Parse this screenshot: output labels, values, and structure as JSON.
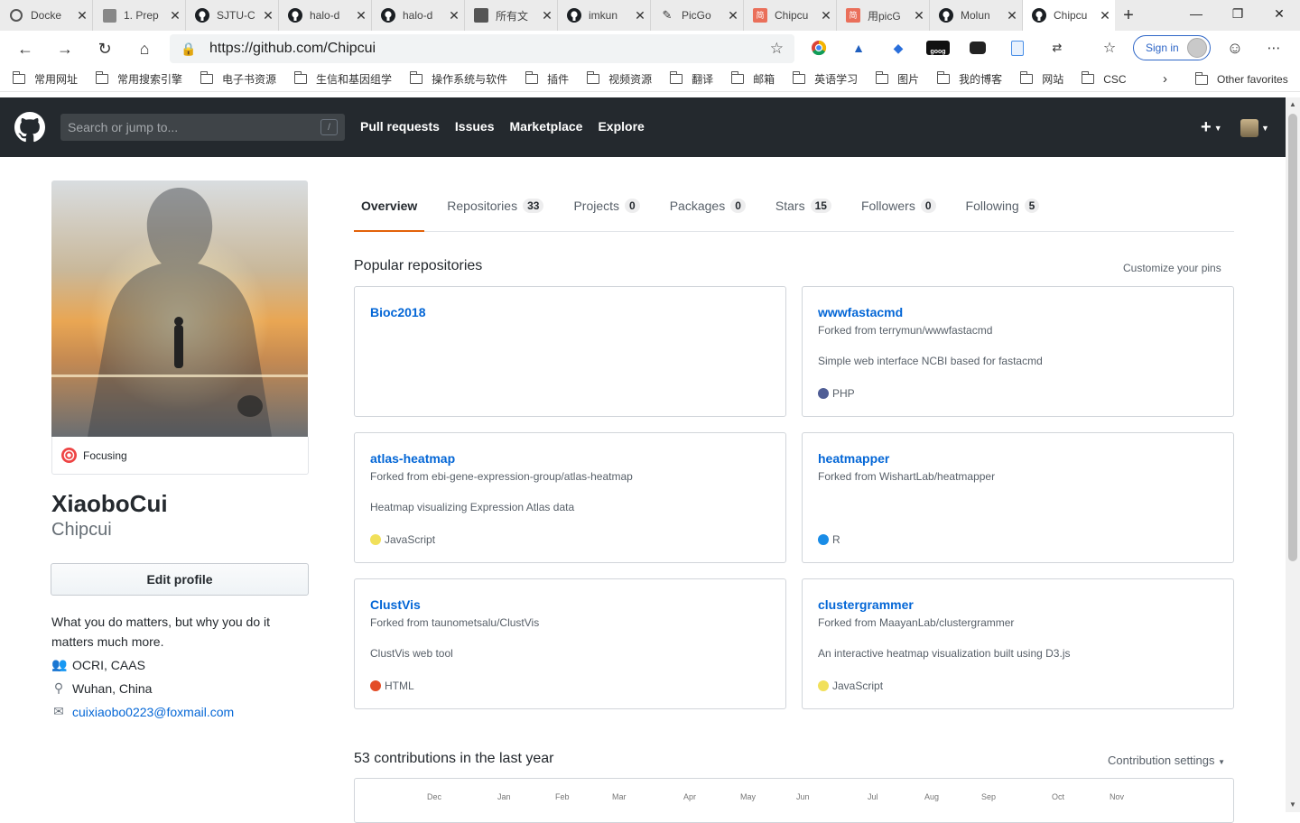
{
  "browser": {
    "tabs": [
      {
        "title": "Docke",
        "icon": "docker-icon"
      },
      {
        "title": "1. Prep",
        "icon": "generic-page-icon"
      },
      {
        "title": "SJTU-C",
        "icon": "github-icon"
      },
      {
        "title": "halo-d",
        "icon": "github-icon"
      },
      {
        "title": "halo-d",
        "icon": "github-icon"
      },
      {
        "title": "所有文",
        "icon": "person-icon"
      },
      {
        "title": "imkun",
        "icon": "github-icon"
      },
      {
        "title": "PicGo",
        "icon": "picgo-icon"
      },
      {
        "title": "Chipcu",
        "icon": "jianshu-icon"
      },
      {
        "title": "用picG",
        "icon": "jianshu-icon"
      },
      {
        "title": "Molun",
        "icon": "github-icon"
      },
      {
        "title": "Chipcu",
        "icon": "github-icon",
        "active": true
      }
    ],
    "url": "https://github.com/Chipcui",
    "signin_label": "Sign in",
    "bookmarks": [
      "常用网址",
      "常用搜索引擎",
      "电子书资源",
      "生信和基因组学",
      "操作系统与软件",
      "插件",
      "视频资源",
      "翻译",
      "邮箱",
      "英语学习",
      "图片",
      "我的博客",
      "网站",
      "CSC"
    ],
    "other_favorites": "Other favorites"
  },
  "header": {
    "search_placeholder": "Search or jump to...",
    "search_shortcut": "/",
    "nav": [
      "Pull requests",
      "Issues",
      "Marketplace",
      "Explore"
    ],
    "plus": "+"
  },
  "profile": {
    "status": "Focusing",
    "fullname": "XiaoboCui",
    "login": "Chipcui",
    "edit_label": "Edit profile",
    "bio": "What you do matters, but why you do it matters much more.",
    "organization": "OCRI, CAAS",
    "location": "Wuhan, China",
    "email": "cuixiaobo0223@foxmail.com"
  },
  "tabs": [
    {
      "label": "Overview",
      "count": null,
      "selected": true
    },
    {
      "label": "Repositories",
      "count": "33"
    },
    {
      "label": "Projects",
      "count": "0"
    },
    {
      "label": "Packages",
      "count": "0"
    },
    {
      "label": "Stars",
      "count": "15"
    },
    {
      "label": "Followers",
      "count": "0"
    },
    {
      "label": "Following",
      "count": "5"
    }
  ],
  "popular": {
    "title": "Popular repositories",
    "customize": "Customize your pins",
    "repos": [
      {
        "name": "Bioc2018",
        "fork": "",
        "desc": "",
        "lang": "",
        "color": ""
      },
      {
        "name": "wwwfastacmd",
        "fork": "Forked from terrymun/wwwfastacmd",
        "desc": "Simple web interface NCBI based for fastacmd",
        "lang": "PHP",
        "color": "#4F5D95"
      },
      {
        "name": "atlas-heatmap",
        "fork": "Forked from ebi-gene-expression-group/atlas-heatmap",
        "desc": "Heatmap visualizing Expression Atlas data",
        "lang": "JavaScript",
        "color": "#f1e05a"
      },
      {
        "name": "heatmapper",
        "fork": "Forked from WishartLab/heatmapper",
        "desc": "",
        "lang": "R",
        "color": "#198CE7"
      },
      {
        "name": "ClustVis",
        "fork": "Forked from taunometsalu/ClustVis",
        "desc": "ClustVis web tool",
        "lang": "HTML",
        "color": "#e34c26"
      },
      {
        "name": "clustergrammer",
        "fork": "Forked from MaayanLab/clustergrammer",
        "desc": "An interactive heatmap visualization built using D3.js",
        "lang": "JavaScript",
        "color": "#f1e05a"
      }
    ]
  },
  "contributions": {
    "title": "53 contributions in the last year",
    "settings": "Contribution settings",
    "months": [
      "Dec",
      "Jan",
      "Feb",
      "Mar",
      "Apr",
      "May",
      "Jun",
      "Jul",
      "Aug",
      "Sep",
      "Oct",
      "Nov"
    ]
  }
}
